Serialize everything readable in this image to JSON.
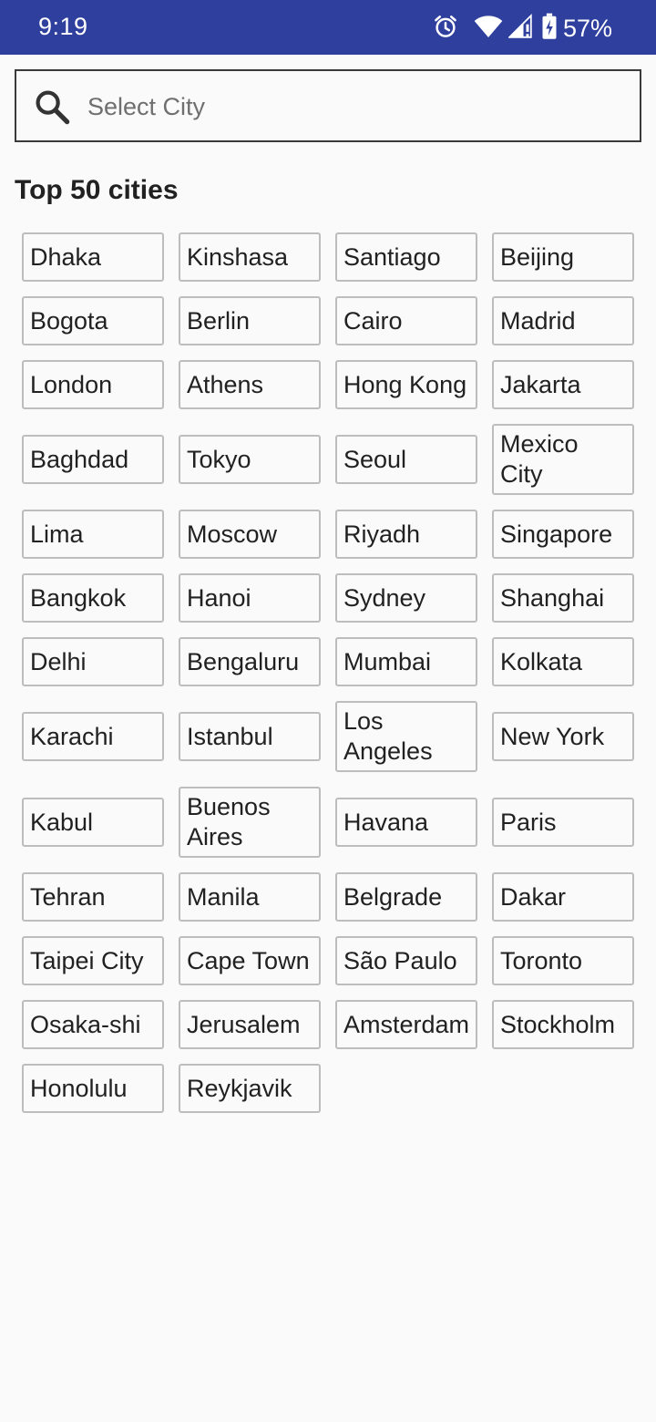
{
  "status_bar": {
    "time": "9:19",
    "battery": "57%",
    "icons": [
      "alarm-icon",
      "wifi-icon",
      "cell-signal-icon",
      "battery-charging-icon"
    ],
    "background": "#2f3f9e"
  },
  "search": {
    "placeholder": "Select City",
    "value": "",
    "icon": "search-icon"
  },
  "section": {
    "title": "Top 50 cities"
  },
  "cities": [
    "Dhaka",
    "Kinshasa",
    "Santiago",
    "Beijing",
    "Bogota",
    "Berlin",
    "Cairo",
    "Madrid",
    "London",
    "Athens",
    "Hong Kong",
    "Jakarta",
    "Baghdad",
    "Tokyo",
    "Seoul",
    "Mexico City",
    "Lima",
    "Moscow",
    "Riyadh",
    "Singapore",
    "Bangkok",
    "Hanoi",
    "Sydney",
    "Shanghai",
    "Delhi",
    "Bengaluru",
    "Mumbai",
    "Kolkata",
    "Karachi",
    "Istanbul",
    "Los Angeles",
    "New York",
    "Kabul",
    "Buenos Aires",
    "Havana",
    "Paris",
    "Tehran",
    "Manila",
    "Belgrade",
    "Dakar",
    "Taipei City",
    "Cape Town",
    "São Paulo",
    "Toronto",
    "Osaka-shi",
    "Jerusalem",
    "Amsterdam",
    "Stockholm",
    "Honolulu",
    "Reykjavik"
  ]
}
